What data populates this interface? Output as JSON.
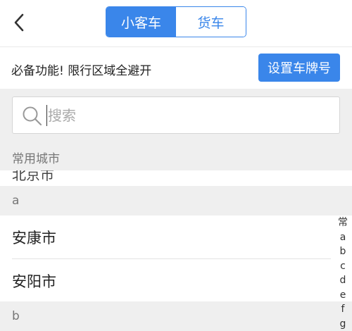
{
  "nav": {
    "tabs": [
      {
        "label": "小客车",
        "active": true
      },
      {
        "label": "货车",
        "active": false
      }
    ]
  },
  "banner": {
    "text": "必备功能! 限行区域全避开",
    "button_label": "设置车牌号"
  },
  "search": {
    "placeholder": "搜索",
    "value": ""
  },
  "list": {
    "common_header": "常用城市",
    "clipped_item": "北京市",
    "sections": [
      {
        "letter": "a",
        "cities": [
          "安康市",
          "安阳市"
        ]
      },
      {
        "letter": "b",
        "cities": []
      }
    ]
  },
  "index_bar": [
    "常",
    "a",
    "b",
    "c",
    "d",
    "e",
    "f",
    "g"
  ],
  "colors": {
    "accent": "#3a86ea",
    "section_bg": "#efefef",
    "section_text": "#777777"
  },
  "icons": {
    "back": "chevron-left-icon",
    "search": "magnifier-icon"
  }
}
